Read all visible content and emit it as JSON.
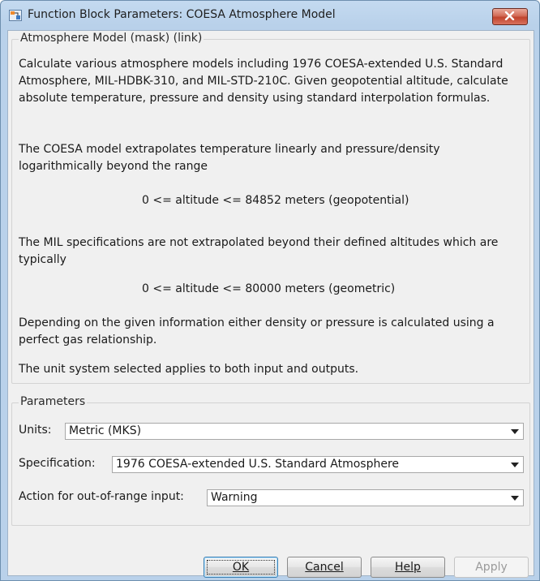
{
  "window": {
    "title": "Function Block Parameters: COESA Atmosphere Model",
    "close_icon": "close-icon"
  },
  "description": {
    "group_title": "Atmosphere Model (mask) (link)",
    "para1": "Calculate various atmosphere models including 1976 COESA-extended U.S. Standard Atmosphere, MIL-HDBK-310, and MIL-STD-210C.  Given geopotential altitude, calculate absolute temperature, pressure and density using standard interpolation formulas.",
    "para2": "The COESA model extrapolates temperature linearly and pressure/density logarithmically beyond the range",
    "range1": "0 <= altitude <= 84852 meters (geopotential)",
    "para3": "The MIL specifications are not extrapolated beyond their defined altitudes which are typically",
    "range2": "0 <= altitude <= 80000 meters (geometric)",
    "para4": "Depending on the given information either density or pressure is calculated using a perfect gas relationship.",
    "para5": "The unit system selected applies to both input and outputs."
  },
  "parameters": {
    "group_title": "Parameters",
    "units_label": "Units:",
    "units_value": "Metric (MKS)",
    "spec_label": "Specification:",
    "spec_value": "1976 COESA-extended U.S. Standard Atmosphere",
    "action_label": "Action for out-of-range input:",
    "action_value": "Warning"
  },
  "buttons": {
    "ok": "OK",
    "cancel": "Cancel",
    "help": "Help",
    "apply": "Apply"
  },
  "colors": {
    "titlebar": "#b9d1ea",
    "close": "#c1432c",
    "dialog_bg": "#f0f0f0"
  }
}
